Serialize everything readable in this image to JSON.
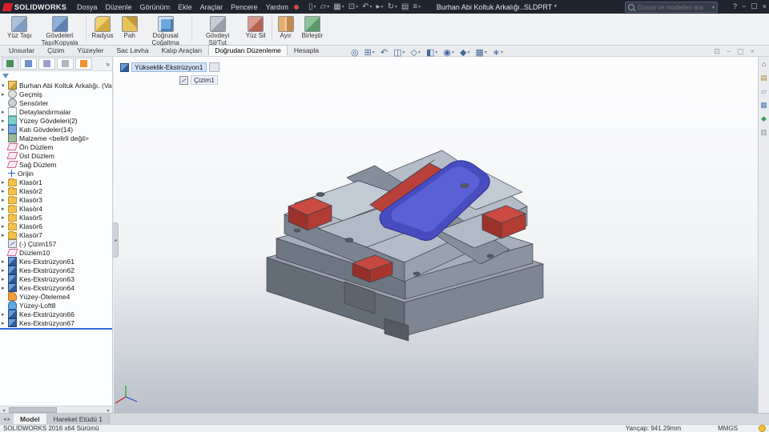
{
  "window": {
    "app_name": "SOLIDWORKS",
    "menus": [
      "Dosya",
      "Düzenle",
      "Görünüm",
      "Ekle",
      "Araçlar",
      "Pencere",
      "Yardım"
    ],
    "document_title": "Burhan Abi Koltuk Arkalığı..SLDPRT *",
    "search_placeholder": "Dosya ve modelleri ara",
    "toolbar_icons": [
      {
        "name": "new-document",
        "glyph": "▯",
        "caret": true
      },
      {
        "name": "open-document",
        "glyph": "▱",
        "caret": true
      },
      {
        "name": "save",
        "glyph": "▦",
        "caret": true
      },
      {
        "name": "print",
        "glyph": "⊡",
        "caret": true
      },
      {
        "name": "undo",
        "glyph": "↶",
        "caret": true
      },
      {
        "name": "select",
        "glyph": "▸",
        "caret": true
      },
      {
        "name": "rebuild",
        "glyph": "↻",
        "caret": true
      },
      {
        "name": "file-properties",
        "glyph": "▤",
        "caret": false
      },
      {
        "name": "options",
        "glyph": "≡",
        "caret": true
      }
    ],
    "window_controls": [
      {
        "name": "help",
        "glyph": "?"
      },
      {
        "name": "minimize",
        "glyph": "−"
      },
      {
        "name": "restore",
        "glyph": "▢"
      },
      {
        "name": "close",
        "glyph": "×"
      }
    ]
  },
  "ribbon": {
    "buttons": [
      {
        "label": "Yüz Taşı",
        "icon": "move-face",
        "caret": false,
        "sep": false
      },
      {
        "label": "Gövdeleri Taşı/Kopyala",
        "icon": "move-copy-bodies",
        "caret": false,
        "sep": true
      },
      {
        "label": "Radyus",
        "icon": "fillet",
        "caret": false,
        "sep": false
      },
      {
        "label": "Pah",
        "icon": "chamfer",
        "caret": false,
        "sep": false
      },
      {
        "label": "Doğrusal Çoğaltma",
        "icon": "linear-pattern",
        "caret": true,
        "sep": true
      },
      {
        "label": "Gövdeyi Sil/Tut",
        "icon": "delete-keep-body",
        "caret": false,
        "sep": false
      },
      {
        "label": "Yüz Sil",
        "icon": "delete-face",
        "caret": false,
        "sep": true
      },
      {
        "label": "Ayır",
        "icon": "split",
        "caret": false,
        "sep": false
      },
      {
        "label": "Birleştir",
        "icon": "combine",
        "caret": false,
        "sep": false
      }
    ]
  },
  "tabs": {
    "items": [
      "Unsurlar",
      "Çizim",
      "Yüzeyler",
      "Sac Levha",
      "Kalıp Araçları",
      "Doğrudan Düzenleme",
      "Hesapla"
    ],
    "active": "Doğrudan Düzenleme"
  },
  "left_panel": {
    "expand_label": "»",
    "tabs": [
      {
        "name": "featuremanager-design-tree",
        "color": "#4a8f5a"
      },
      {
        "name": "propertymanager",
        "color": "#6f8fc8"
      },
      {
        "name": "configurationmanager",
        "color": "#9aa0c8"
      },
      {
        "name": "dimxpertmanager",
        "color": "#b0b6be"
      },
      {
        "name": "displaymanager",
        "color": "#f09030"
      }
    ]
  },
  "feature_tree": {
    "root_label": "Burhan Abi Koltuk Arkalığı.  (Varsayılan<<Varsay",
    "items": [
      {
        "label": "Geçmiş",
        "type": "history",
        "arrow": true
      },
      {
        "label": "Sensörler",
        "type": "sensors",
        "arrow": false
      },
      {
        "label": "Detaylandırmalar",
        "type": "annotations",
        "arrow": true
      },
      {
        "label": "Yüzey Gövdeleri(2)",
        "type": "surface-folder",
        "arrow": true
      },
      {
        "label": "Katı Gövdeler(14)",
        "type": "solid-folder",
        "arrow": true
      },
      {
        "label": "Malzeme <belirli değil>",
        "type": "material",
        "arrow": false
      },
      {
        "label": "Ön Düzlem",
        "type": "plane",
        "arrow": false
      },
      {
        "label": "Üst Düzlem",
        "type": "plane",
        "arrow": false
      },
      {
        "label": "Sağ Düzlem",
        "type": "plane",
        "arrow": false
      },
      {
        "label": "Orijin",
        "type": "origin",
        "arrow": false
      },
      {
        "label": "Klasör1",
        "type": "folder",
        "arrow": true
      },
      {
        "label": "Klasör2",
        "type": "folder",
        "arrow": true
      },
      {
        "label": "Klasör3",
        "type": "folder",
        "arrow": true
      },
      {
        "label": "Klasör4",
        "type": "folder",
        "arrow": true
      },
      {
        "label": "Klasör5",
        "type": "folder",
        "arrow": true
      },
      {
        "label": "Klasör6",
        "type": "folder",
        "arrow": true
      },
      {
        "label": "Klasör7",
        "type": "folder",
        "arrow": true
      },
      {
        "label": "(-) Çizim157",
        "type": "sketch",
        "arrow": false
      },
      {
        "label": "Düzlem10",
        "type": "plane",
        "arrow": false
      },
      {
        "label": "Kes-Ekstrüzyon61",
        "type": "cut-extrude",
        "arrow": true
      },
      {
        "label": "Kes-Ekstrüzyon62",
        "type": "cut-extrude",
        "arrow": true
      },
      {
        "label": "Kes-Ekstrüzyon63",
        "type": "cut-extrude",
        "arrow": true
      },
      {
        "label": "Kes-Ekstrüzyon64",
        "type": "cut-extrude",
        "arrow": true
      },
      {
        "label": "Yüzey-Öteleme4",
        "type": "surface-offset",
        "arrow": false
      },
      {
        "label": "Yüzey-Loft8",
        "type": "surface-loft",
        "arrow": false
      },
      {
        "label": "Kes-Ekstrüzyon66",
        "type": "cut-extrude",
        "arrow": true
      },
      {
        "label": "Kes-Ekstrüzyon67",
        "type": "cut-extrude",
        "arrow": true
      }
    ]
  },
  "breadcrumb": {
    "feature": "Yükseklik-Ekstrüzyon1",
    "sub_feature": "Çizim1"
  },
  "viewport": {
    "window_controls": [
      {
        "name": "doc-restore",
        "glyph": "⊡"
      },
      {
        "name": "doc-minimize",
        "glyph": "−"
      },
      {
        "name": "doc-maximize",
        "glyph": "▢"
      },
      {
        "name": "doc-close",
        "glyph": "×"
      }
    ],
    "headsup_icons": [
      {
        "name": "zoom-fit",
        "glyph": "◎",
        "caret": false
      },
      {
        "name": "zoom-area",
        "glyph": "⊞",
        "caret": true
      },
      {
        "name": "previous-view",
        "glyph": "↶",
        "caret": false
      },
      {
        "name": "section-view",
        "glyph": "◫",
        "caret": true
      },
      {
        "name": "view-orientation",
        "glyph": "◇",
        "caret": true
      },
      {
        "name": "display-style",
        "glyph": "◧",
        "caret": true
      },
      {
        "name": "hide-show-items",
        "glyph": "◉",
        "caret": true
      },
      {
        "name": "edit-appearance",
        "glyph": "◆",
        "caret": true
      },
      {
        "name": "apply-scene",
        "glyph": "▦",
        "caret": true
      },
      {
        "name": "view-settings",
        "glyph": "∗",
        "caret": true
      }
    ]
  },
  "task_pane": {
    "icons": [
      {
        "name": "home",
        "glyph": "⌂",
        "color": "#555b64"
      },
      {
        "name": "design-library",
        "glyph": "▤",
        "color": "#b5862e"
      },
      {
        "name": "file-explorer",
        "glyph": "▱",
        "color": "#6a86b8"
      },
      {
        "name": "view-palette",
        "glyph": "▦",
        "color": "#4a7ab8"
      },
      {
        "name": "appearances-scenes",
        "glyph": "◆",
        "color": "#3f9e5c"
      },
      {
        "name": "custom-properties",
        "glyph": "▥",
        "color": "#8a9098"
      }
    ]
  },
  "bottom_bar": {
    "tabs": [
      "Model",
      "Hareket Etüdü 1"
    ],
    "active": "Model"
  },
  "status_bar": {
    "version": "SOLIDWORKS 2016 x64 Sürümü",
    "measurement": "Yarıçap: 941.29mm",
    "units": "MMGS"
  },
  "colors": {
    "part_blue": "#474dbe",
    "clamp_red": "#cc4a42",
    "rollback_blue": "#2f6fd6"
  }
}
